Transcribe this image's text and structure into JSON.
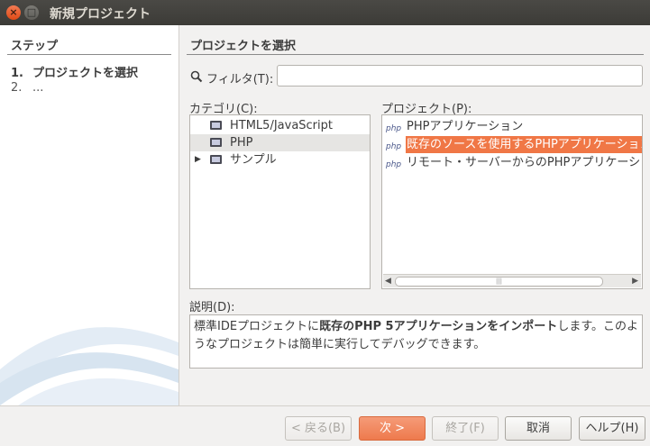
{
  "window": {
    "title": "新規プロジェクト",
    "close_icon": "×",
    "max_icon": "□"
  },
  "sidebar": {
    "title": "ステップ",
    "steps": [
      {
        "num": "1.",
        "label": "プロジェクトを選択"
      },
      {
        "num": "2.",
        "label": "..."
      }
    ]
  },
  "main": {
    "title": "プロジェクトを選択",
    "filter": {
      "label": "フィルタ(T):",
      "value": ""
    },
    "categories": {
      "label": "カテゴリ(C):",
      "items": [
        {
          "label": "HTML5/JavaScript",
          "expander": ""
        },
        {
          "label": "PHP",
          "expander": ""
        },
        {
          "label": "サンプル",
          "expander": "▶"
        }
      ]
    },
    "projects": {
      "label": "プロジェクト(P):",
      "items": [
        {
          "label": "PHPアプリケーション"
        },
        {
          "label": "既存のソースを使用するPHPアプリケーション"
        },
        {
          "label": "リモート・サーバーからのPHPアプリケーション"
        }
      ],
      "scroll_left": "◀",
      "scroll_right": "▶",
      "scroll_grip": "|||"
    },
    "description": {
      "label": "説明(D):",
      "text_before": "標準IDEプロジェクトに",
      "text_bold": "既存のPHP 5アプリケーションをインポート",
      "text_after": "します。このようなプロジェクトは簡単に実行してデバッグできます。"
    }
  },
  "buttons": {
    "back": "< 戻る(B)",
    "next": "次 >",
    "finish": "終了(F)",
    "cancel": "取消",
    "help": "ヘルプ(H)"
  },
  "colors": {
    "selection": "#f07746",
    "titlebar": "#3c3b37"
  }
}
